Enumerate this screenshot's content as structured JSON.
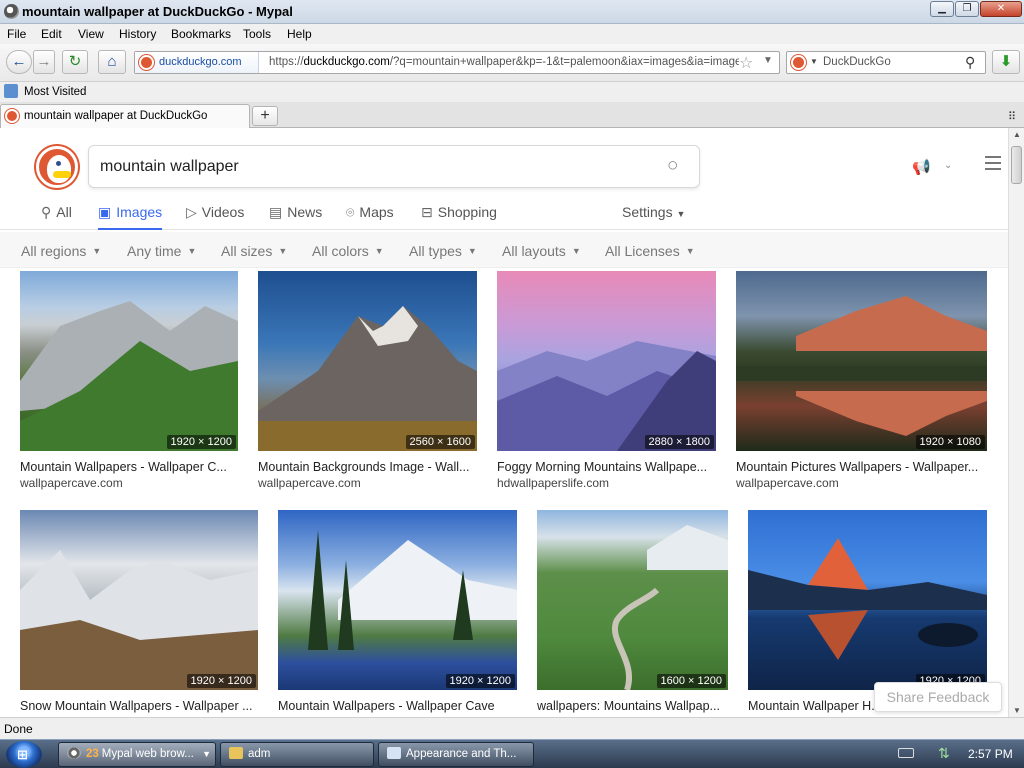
{
  "window": {
    "title": "mountain wallpaper at DuckDuckGo - Mypal",
    "min_glyph": "▁",
    "max_glyph": "❐",
    "close_glyph": "✕"
  },
  "menu": [
    "File",
    "Edit",
    "View",
    "History",
    "Bookmarks",
    "Tools",
    "Help"
  ],
  "nav": {
    "back_glyph": "←",
    "forward_glyph": "→",
    "reload_glyph": "↻",
    "home_glyph": "⌂",
    "domain_label": "duckduckgo.com",
    "url_prefix": "https://",
    "url_host": "duckduckgo.com",
    "url_rest": "/?q=mountain+wallpaper&kp=-1&t=palemoon&iax=images&ia=images",
    "search_placeholder": "DuckDuckGo",
    "download_glyph": "⬇"
  },
  "bookmarks": {
    "label": "Most Visited"
  },
  "tabs": {
    "active_tab_title": "mountain wallpaper at DuckDuckGo",
    "new_tab_glyph": "+"
  },
  "page": {
    "query": "mountain wallpaper",
    "nav_tabs": [
      {
        "label": "All",
        "icon": "search-icon"
      },
      {
        "label": "Images",
        "icon": "image-icon"
      },
      {
        "label": "Videos",
        "icon": "play-icon"
      },
      {
        "label": "News",
        "icon": "newspaper-icon"
      },
      {
        "label": "Maps",
        "icon": "map-pin-icon"
      },
      {
        "label": "Shopping",
        "icon": "shopping-bag-icon"
      }
    ],
    "settings_label": "Settings",
    "filters": [
      "All regions",
      "Any time",
      "All sizes",
      "All colors",
      "All types",
      "All layouts",
      "All Licenses"
    ],
    "results": [
      {
        "title": "Mountain Wallpapers - Wallpaper C...",
        "source": "wallpapercave.com",
        "dims": "1920 × 1200"
      },
      {
        "title": "Mountain Backgrounds Image - Wall...",
        "source": "wallpapercave.com",
        "dims": "2560 × 1600"
      },
      {
        "title": "Foggy Morning Mountains Wallpape...",
        "source": "hdwallpaperslife.com",
        "dims": "2880 × 1800"
      },
      {
        "title": "Mountain Pictures Wallpapers - Wallpaper...",
        "source": "wallpapercave.com",
        "dims": "1920 × 1080"
      },
      {
        "title": "Snow Mountain Wallpapers - Wallpaper ...",
        "source": "",
        "dims": "1920 × 1200"
      },
      {
        "title": "Mountain Wallpapers - Wallpaper Cave",
        "source": "",
        "dims": "1920 × 1200"
      },
      {
        "title": "wallpapers: Mountains Wallpap...",
        "source": "",
        "dims": "1600 × 1200"
      },
      {
        "title": "Mountain Wallpaper H...",
        "source": "",
        "dims": "1920 × 1200"
      }
    ],
    "share_feedback": "Share Feedback"
  },
  "status": {
    "text": "Done"
  },
  "taskbar": {
    "start_glyph": "⊞",
    "tasks": [
      {
        "badge": "23",
        "label": "Mypal web brow..."
      },
      {
        "label": "adm"
      },
      {
        "label": "Appearance and Th..."
      }
    ],
    "clock": "2:57 PM"
  }
}
